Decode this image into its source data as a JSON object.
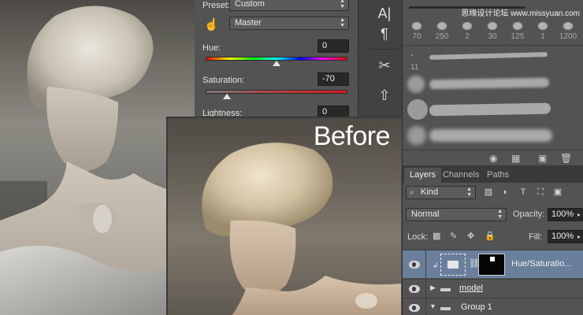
{
  "adjustments": {
    "preset_label": "Preset:",
    "preset_value": "Custom",
    "channel_value": "Master",
    "hue": {
      "label": "Hue:",
      "value": "0",
      "fraction": 0.5
    },
    "saturation": {
      "label": "Saturation:",
      "value": "-70",
      "fraction": 0.15
    },
    "lightness": {
      "label": "Lightness:",
      "value": "0"
    }
  },
  "photo": {
    "before_label": "Before"
  },
  "tools": [
    {
      "icon": "character-icon",
      "glyph": "A|"
    },
    {
      "icon": "paragraph-icon",
      "glyph": "¶"
    },
    {
      "icon": "tool-presets-icon",
      "glyph": "✂"
    },
    {
      "icon": "clone-source-icon",
      "glyph": "⇧"
    }
  ],
  "brushes": {
    "watermark": "思缘设计论坛 www.missyuan.com",
    "preset_sizes": [
      "70",
      "250",
      "2",
      "30",
      "125",
      "1",
      "1200"
    ],
    "first_brush_size": "11"
  },
  "layers": {
    "tabs": [
      "Layers",
      "Channels",
      "Paths"
    ],
    "active_tab": "Layers",
    "filter_kind": "Kind",
    "blend_mode": "Normal",
    "opacity_label": "Opacity:",
    "opacity_value": "100%",
    "lock_label": "Lock:",
    "fill_label": "Fill:",
    "fill_value": "100%",
    "items": [
      {
        "name": "Hue/Saturatio...",
        "type": "adjustment",
        "selected": true
      },
      {
        "name": "model",
        "type": "group",
        "expanded": false
      },
      {
        "name": "Group 1",
        "type": "group",
        "expanded": true
      }
    ]
  },
  "colors": {
    "panel_bg": "#535353",
    "selected_layer": "#6a7f9b",
    "field_bg": "#282828"
  }
}
